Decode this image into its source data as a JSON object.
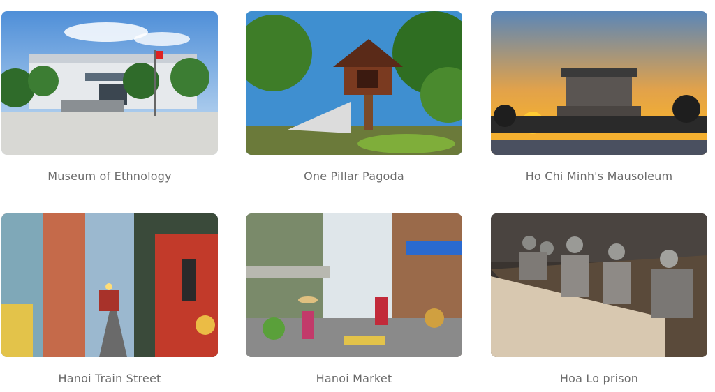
{
  "attractions": [
    {
      "name": "Museum of Ethnology",
      "image": "museum-of-ethnology-photo"
    },
    {
      "name": "One Pillar Pagoda",
      "image": "one-pillar-pagoda-photo"
    },
    {
      "name": "Ho Chi Minh's Mausoleum",
      "image": "ho-chi-minh-mausoleum-photo"
    },
    {
      "name": "Hanoi Train Street",
      "image": "hanoi-train-street-photo"
    },
    {
      "name": "Hanoi Market",
      "image": "hanoi-market-photo"
    },
    {
      "name": "Hoa Lo prison",
      "image": "hoa-lo-prison-photo"
    }
  ]
}
